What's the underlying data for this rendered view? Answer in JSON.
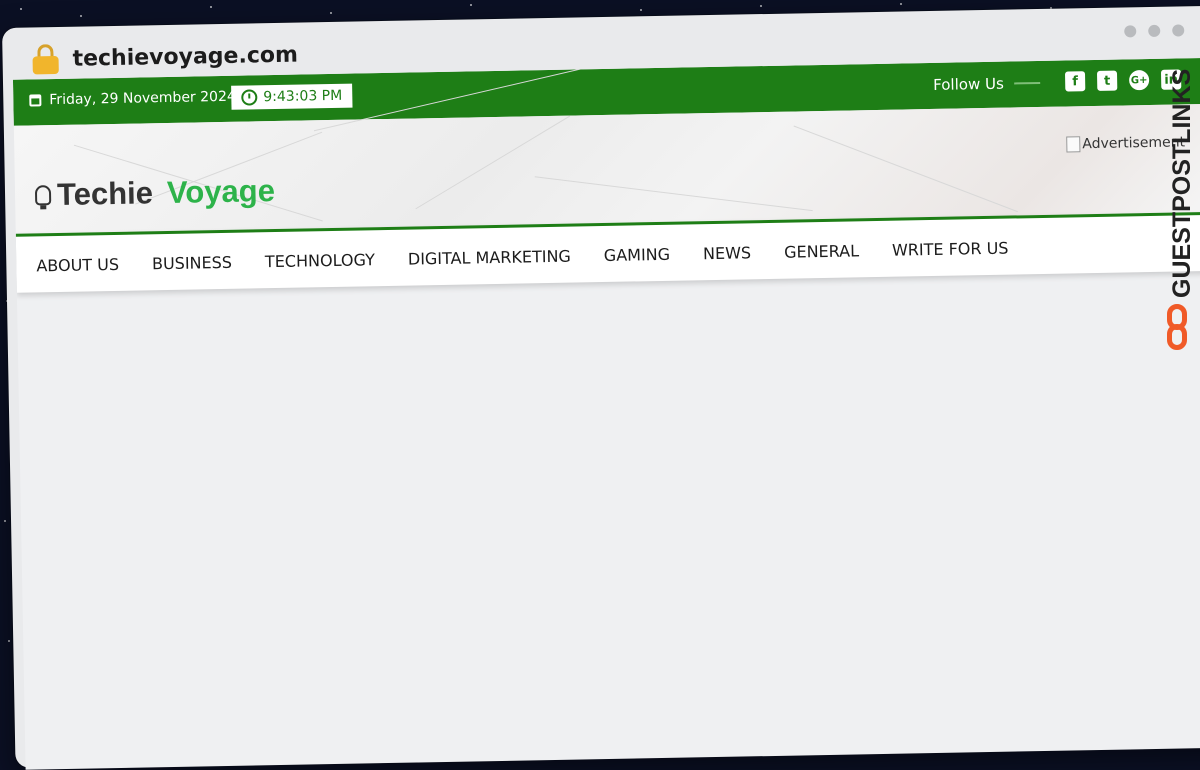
{
  "browser": {
    "domain": "techievoyage.com"
  },
  "topbar": {
    "date": "Friday, 29 November 2024",
    "time": "9:43:03 PM",
    "follow_label": "Follow Us",
    "social_icons": [
      "facebook-icon",
      "twitter-icon",
      "google-plus-icon",
      "linkedin-icon"
    ],
    "facebook_glyph": "f",
    "twitter_glyph": "t",
    "google_glyph": "G+",
    "linkedin_glyph": "in",
    "color": "#1e7e16"
  },
  "header": {
    "logo_word1": "Techie",
    "logo_word2": "Voyage",
    "logo_word2_color": "#2db34a",
    "ad_alt": "Advertisement"
  },
  "nav": {
    "items": [
      "ABOUT US",
      "BUSINESS",
      "TECHNOLOGY",
      "DIGITAL MARKETING",
      "GAMING",
      "NEWS",
      "GENERAL",
      "WRITE FOR US"
    ]
  },
  "watermark": {
    "text": "GUESTPOSTLINKS",
    "accent": "#f05a28"
  }
}
